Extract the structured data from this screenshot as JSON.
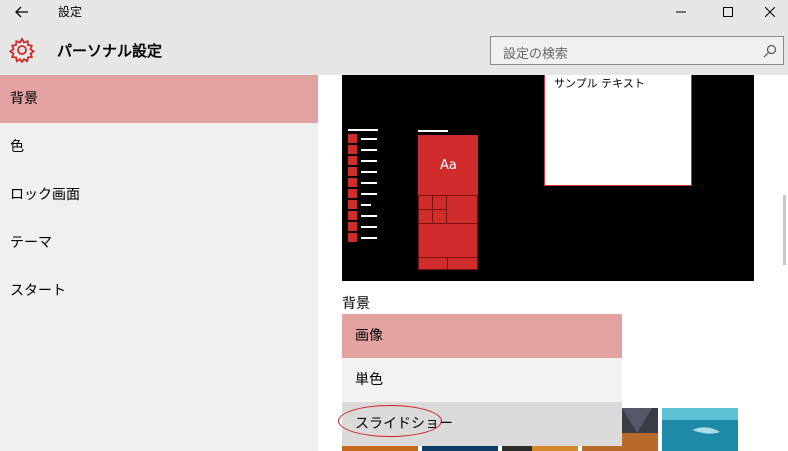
{
  "window": {
    "title": "設定",
    "back_icon": "back-arrow-icon",
    "minimize_icon": "minimize-icon",
    "maximize_icon": "maximize-icon",
    "close_icon": "close-icon"
  },
  "header": {
    "title": "パーソナル設定",
    "icon": "gear-icon",
    "accent": "#d12c2c"
  },
  "search": {
    "placeholder": "設定の検索",
    "icon": "search-icon"
  },
  "sidebar": {
    "items": [
      {
        "label": "背景",
        "selected": true
      },
      {
        "label": "色",
        "selected": false
      },
      {
        "label": "ロック画面",
        "selected": false
      },
      {
        "label": "テーマ",
        "selected": false
      },
      {
        "label": "スタート",
        "selected": false
      }
    ],
    "selected_color": "#e3a2a2"
  },
  "preview": {
    "sample_text": "サンプル テキスト",
    "tile_text": "Aa"
  },
  "background": {
    "label": "背景",
    "options": [
      {
        "label": "画像",
        "selected": true
      },
      {
        "label": "単色",
        "selected": false
      },
      {
        "label": "スライドショー",
        "selected": false,
        "highlighted": true
      }
    ]
  }
}
